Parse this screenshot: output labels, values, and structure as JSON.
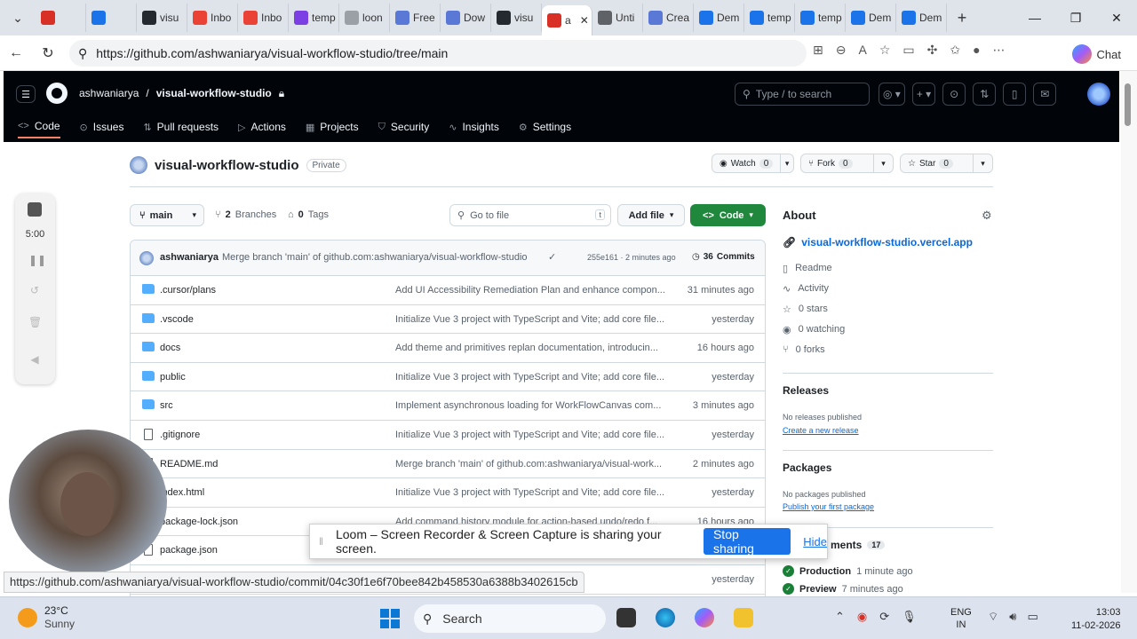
{
  "browser": {
    "tabs": [
      {
        "label": "",
        "color": "#d93025"
      },
      {
        "label": "",
        "color": "#1a73e8"
      },
      {
        "label": "visu",
        "color": "#24292f"
      },
      {
        "label": "Inbo",
        "color": "#ea4335"
      },
      {
        "label": "Inbo",
        "color": "#ea4335"
      },
      {
        "label": "temp",
        "color": "#7b3fe4"
      },
      {
        "label": "loon",
        "color": "#9aa0a6"
      },
      {
        "label": "Free",
        "color": "#5a78d6"
      },
      {
        "label": "Dow",
        "color": "#5a78d6"
      },
      {
        "label": "visu",
        "color": "#24292f"
      },
      {
        "label": "a",
        "color": "#d93025",
        "active": true
      },
      {
        "label": "Unti",
        "color": "#5f6368"
      },
      {
        "label": "Crea",
        "color": "#5a78d6"
      },
      {
        "label": "Dem",
        "color": "#1a73e8"
      },
      {
        "label": "temp",
        "color": "#1a73e8"
      },
      {
        "label": "temp",
        "color": "#1a73e8"
      },
      {
        "label": "Dem",
        "color": "#1a73e8"
      },
      {
        "label": "Dem",
        "color": "#1a73e8"
      }
    ],
    "url": "https://github.com/ashwaniarya/visual-workflow-studio/tree/main",
    "copilot_label": "Chat"
  },
  "github": {
    "owner": "ashwaniarya",
    "repo": "visual-workflow-studio",
    "search_placeholder": "Type / to search",
    "nav": [
      {
        "label": "Code",
        "icon": "code-icon",
        "glyph": "<>",
        "active": true
      },
      {
        "label": "Issues",
        "icon": "issue-icon",
        "glyph": "⊙"
      },
      {
        "label": "Pull requests",
        "icon": "pull-request-icon",
        "glyph": "⇅"
      },
      {
        "label": "Actions",
        "icon": "play-icon",
        "glyph": "▷"
      },
      {
        "label": "Projects",
        "icon": "table-icon",
        "glyph": "▦"
      },
      {
        "label": "Security",
        "icon": "shield-icon",
        "glyph": "⛉"
      },
      {
        "label": "Insights",
        "icon": "graph-icon",
        "glyph": "∿"
      },
      {
        "label": "Settings",
        "icon": "gear-icon",
        "glyph": "⚙"
      }
    ],
    "visibility": "Private",
    "watch": {
      "label": "Watch",
      "count": "0"
    },
    "fork": {
      "label": "Fork",
      "count": "0"
    },
    "star": {
      "label": "Star",
      "count": "0"
    },
    "branch": "main",
    "branches_count": "2",
    "branches_label": "Branches",
    "tags_count": "0",
    "tags_label": "Tags",
    "goto_placeholder": "Go to file",
    "goto_key": "t",
    "add_file_label": "Add file",
    "code_label": "Code",
    "latest_commit": {
      "author": "ashwaniarya",
      "message": "Merge branch 'main' of github.com:ashwaniarya/visual-workflow-studio",
      "sha_time": "255e161 · 2 minutes ago",
      "commits_count": "36",
      "commits_label": "Commits"
    },
    "files": [
      {
        "name": ".cursor/plans",
        "type": "dir",
        "message": "Add UI Accessibility Remediation Plan and enhance compon...",
        "time": "31 minutes ago"
      },
      {
        "name": ".vscode",
        "type": "dir",
        "message": "Initialize Vue 3 project with TypeScript and Vite; add core file...",
        "time": "yesterday"
      },
      {
        "name": "docs",
        "type": "dir",
        "message": "Add theme and primitives replan documentation, introducin...",
        "time": "16 hours ago"
      },
      {
        "name": "public",
        "type": "dir",
        "message": "Initialize Vue 3 project with TypeScript and Vite; add core file...",
        "time": "yesterday"
      },
      {
        "name": "src",
        "type": "dir",
        "message": "Implement asynchronous loading for WorkFlowCanvas com...",
        "time": "3 minutes ago"
      },
      {
        "name": ".gitignore",
        "type": "file",
        "message": "Initialize Vue 3 project with TypeScript and Vite; add core file...",
        "time": "yesterday"
      },
      {
        "name": "README.md",
        "type": "file",
        "message": "Merge branch 'main' of github.com:ashwaniarya/visual-work...",
        "time": "2 minutes ago"
      },
      {
        "name": "index.html",
        "type": "file",
        "message": "Initialize Vue 3 project with TypeScript and Vite; add core file...",
        "time": "yesterday"
      },
      {
        "name": "package-lock.json",
        "type": "file",
        "message": "Add command history module for action-based undo/redo f...",
        "time": "16 hours ago"
      },
      {
        "name": "package.json",
        "type": "file",
        "message": "",
        "time": ""
      },
      {
        "name": "",
        "type": "file",
        "message": "",
        "time": "yesterday"
      }
    ],
    "about": {
      "title": "About",
      "link": "visual-workflow-studio.vercel.app",
      "items": [
        {
          "label": "Readme",
          "glyph": "▯"
        },
        {
          "label": "Activity",
          "glyph": "∿"
        },
        {
          "label": "0 stars",
          "glyph": "☆"
        },
        {
          "label": "0 watching",
          "glyph": "◉"
        },
        {
          "label": "0 forks",
          "glyph": "⑂"
        }
      ]
    },
    "releases": {
      "title": "Releases",
      "note": "No releases published",
      "link": "Create a new release"
    },
    "packages": {
      "title": "Packages",
      "note": "No packages published",
      "link": "Publish your first package"
    },
    "deployments": {
      "title": "ments",
      "count": "17",
      "items": [
        {
          "name": "Production",
          "time": "1 minute ago"
        },
        {
          "name": "Preview",
          "time": "7 minutes ago"
        }
      ]
    }
  },
  "loom": {
    "timer": "5:00",
    "share_text": "Loom – Screen Recorder & Screen Capture is sharing your screen.",
    "stop_label": "Stop sharing",
    "hide_label": "Hide"
  },
  "status_url": "https://github.com/ashwaniarya/visual-workflow-studio/commit/04c30f1e6f70bee842b458530a6388b3402615cb",
  "taskbar": {
    "temp": "23°C",
    "condition": "Sunny",
    "search_label": "Search",
    "lang_line1": "ENG",
    "lang_line2": "IN",
    "time": "13:03",
    "date": "11-02-2026"
  }
}
